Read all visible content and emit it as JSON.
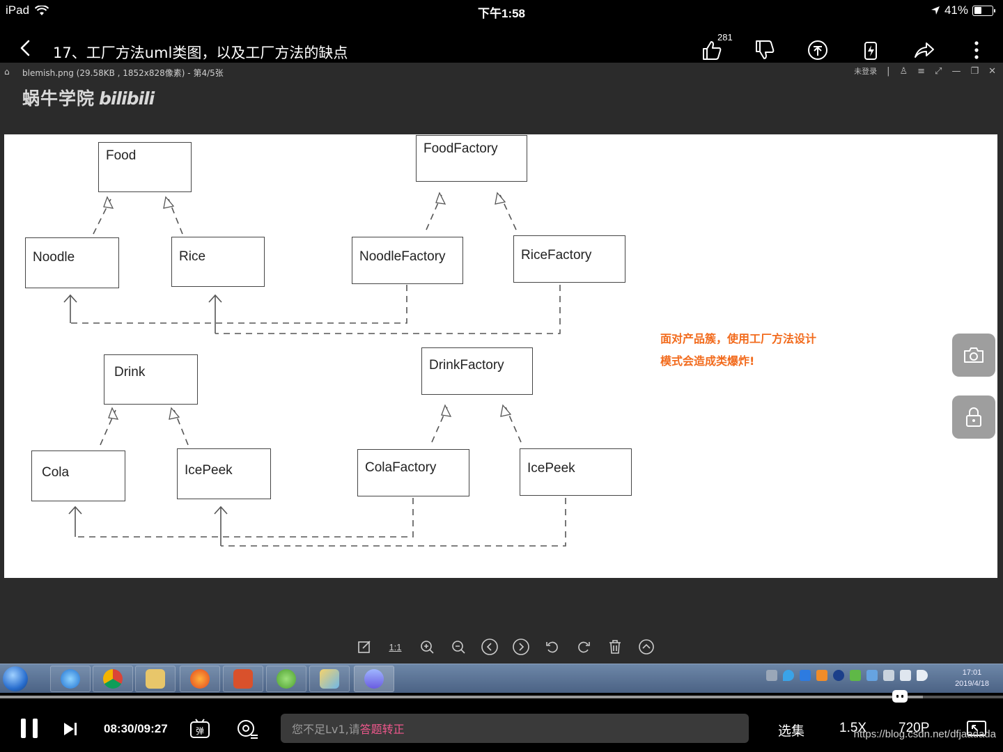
{
  "status_bar": {
    "device": "iPad",
    "time": "下午1:58",
    "battery": "41%",
    "battery_level": 0.41
  },
  "header": {
    "title": "17、工厂方法uml类图，以及工厂方法的缺点",
    "like_count": "281"
  },
  "viewer": {
    "file_info": "blemish.png (29.58KB , 1852x828像素) - 第4/5张",
    "login": "未登录",
    "watermark_text": "蜗牛学院",
    "watermark_brand": "bilibili",
    "toolbar_ratio_label": "1:1"
  },
  "uml": {
    "food": "Food",
    "food_factory": "FoodFactory",
    "noodle": "Noodle",
    "rice": "Rice",
    "noodle_factory": "NoodleFactory",
    "rice_factory": "RiceFactory",
    "drink": "Drink",
    "drink_factory": "DrinkFactory",
    "cola": "Cola",
    "icepeek": "IcePeek",
    "cola_factory": "ColaFactory",
    "icepeek_factory": "IcePeek"
  },
  "note": {
    "line1": "面对产品簇，使用工厂方法设计",
    "line2": "模式会造成类爆炸!"
  },
  "taskbar": {
    "clock_time": "17:01",
    "clock_date": "2019/4/18"
  },
  "player": {
    "time": "08:30/09:27",
    "progress": 0.8969,
    "buffered": 0.92,
    "danmaku_placeholder": "您不足Lv1,请",
    "danmaku_link": "答题转正",
    "episodes": "选集",
    "speed": "1.5X",
    "quality": "720P"
  },
  "watermark_url": "https://blog.csdn.net/dfjaadada",
  "colors": {
    "accent_pink": "#f0588d",
    "note_orange": "#f26b1d",
    "canvas_bg": "#ffffff",
    "viewer_bg": "#2b2b2b"
  }
}
